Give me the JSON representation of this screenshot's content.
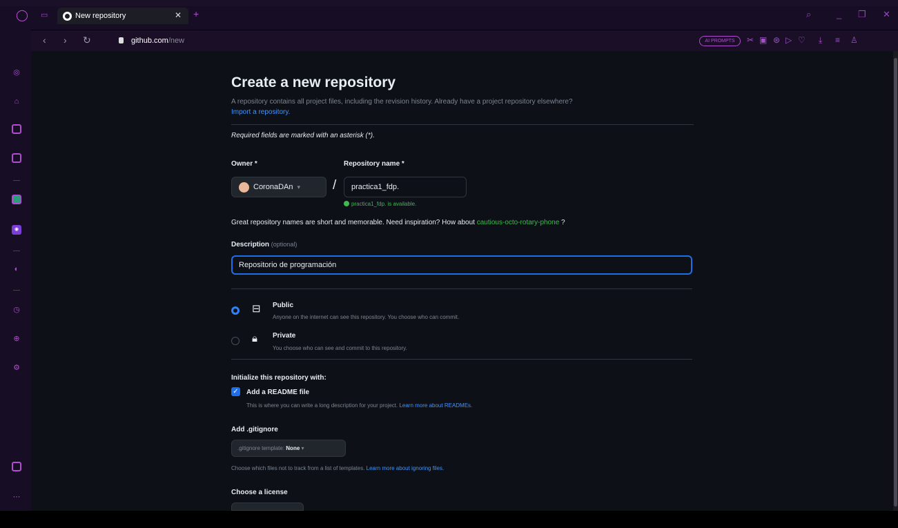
{
  "browser": {
    "tab_title": "New repository",
    "url_host": "github.com",
    "url_path": "/new",
    "ai_prompts": "AI PROMPTS"
  },
  "page": {
    "title": "Create a new repository",
    "subtitle": "A repository contains all project files, including the revision history. Already have a project repository elsewhere?",
    "import_link": "Import a repository.",
    "required_note": "Required fields are marked with an asterisk (*).",
    "owner_label": "Owner *",
    "owner_value": "CoronaDAn",
    "repo_name_label": "Repository name *",
    "repo_name_value": "practica1_fdp.",
    "availability": "practica1_fdp. is available.",
    "great_names": "Great repository names are short and memorable. Need inspiration? How about",
    "suggestion": "cautious-octo-rotary-phone",
    "suggestion_suffix": " ?",
    "description_label": "Description",
    "description_optional": "(optional)",
    "description_value": "Repositorio de programación",
    "public_title": "Public",
    "public_desc": "Anyone on the internet can see this repository. You choose who can commit.",
    "private_title": "Private",
    "private_desc": "You choose who can see and commit to this repository.",
    "init_label": "Initialize this repository with:",
    "readme_label": "Add a README file",
    "readme_desc": "This is where you can write a long description for your project.",
    "readme_link": "Learn more about READMEs.",
    "gitignore_label": "Add .gitignore",
    "gitignore_template": ".gitignore template:",
    "gitignore_value": "None",
    "gitignore_desc": "Choose which files not to track from a list of templates.",
    "gitignore_link": "Learn more about ignoring files.",
    "license_label": "Choose a license"
  },
  "colors": {
    "accent": "#1f6feb",
    "success": "#3fb950",
    "browser_accent": "#b04dd0"
  }
}
